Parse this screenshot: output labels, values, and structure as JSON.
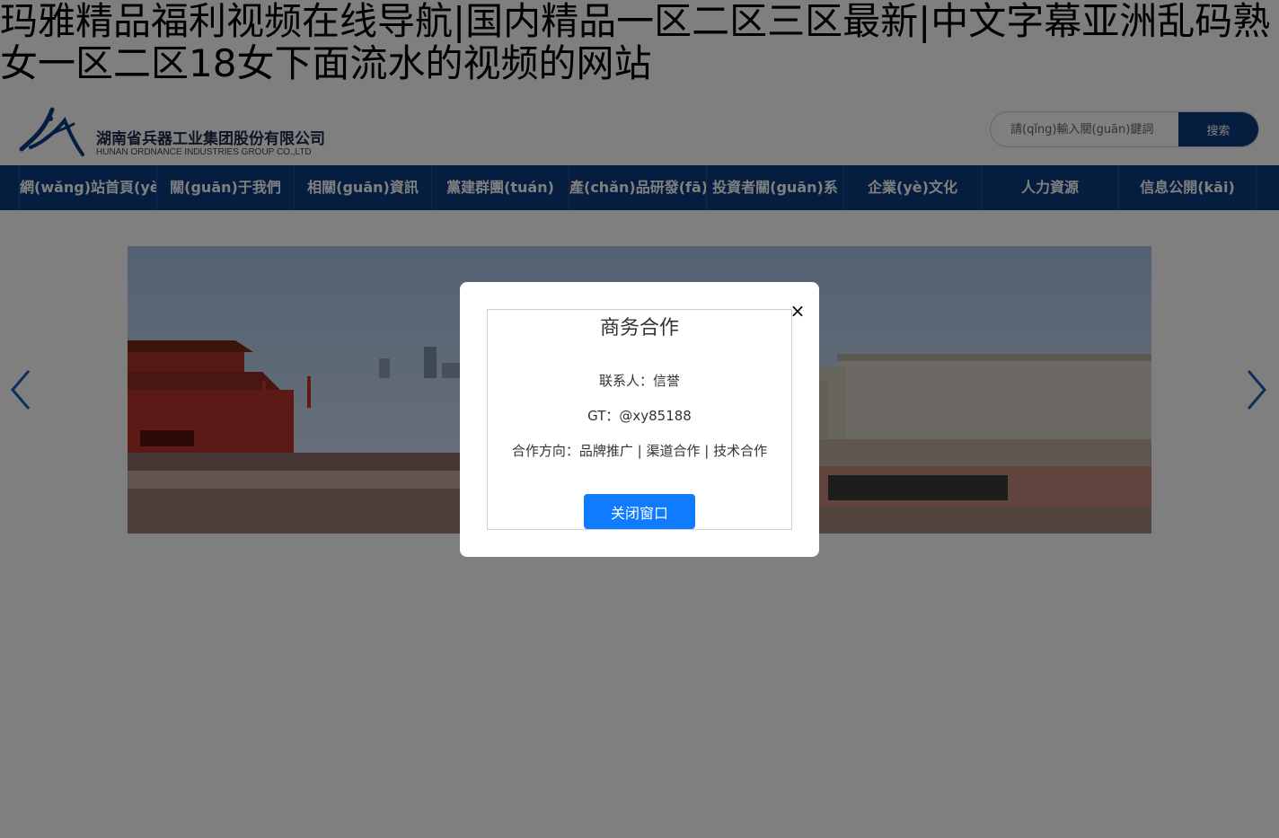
{
  "page": {
    "title": "玛雅精品福利视频在线导航|国内精品一区二区三区最新|中文字幕亚洲乱码熟女一区二区18女下面流水的视频的网站"
  },
  "header": {
    "company_name": "湖南省兵器工业集团股份有限公司",
    "company_name_en": "HUNAN ORDNANCE INDUSTRIES GROUP CO.,LTD",
    "search_placeholder": "請(qǐng)輸入關(guān)鍵詞",
    "search_button": "搜索"
  },
  "nav": {
    "items": [
      {
        "label": "網(wǎng)站首頁(yè)"
      },
      {
        "label": "關(guān)于我們"
      },
      {
        "label": "相關(guān)資訊"
      },
      {
        "label": "黨建群團(tuán)"
      },
      {
        "label": "產(chǎn)品研發(fā)"
      },
      {
        "label": "投資者關(guān)系"
      },
      {
        "label": "企業(yè)文化"
      },
      {
        "label": "人力資源"
      },
      {
        "label": "信息公開(kāi)"
      }
    ]
  },
  "banner": {
    "image": "tiananmen-square-celebration-photo",
    "prev_icon": "chevron-left-icon",
    "next_icon": "chevron-right-icon"
  },
  "modal": {
    "title": "商务合作",
    "contact": "联系人：信誉",
    "gt": "GT：@xy85188",
    "direction": "合作方向：品牌推广 | 渠道合作 | 技术合作",
    "close_button": "关闭窗口",
    "close_icon": "×"
  },
  "colors": {
    "nav_bg": "#0b3a7e",
    "accent_button": "#0f7cff",
    "arrow": "#1a5fb4"
  }
}
